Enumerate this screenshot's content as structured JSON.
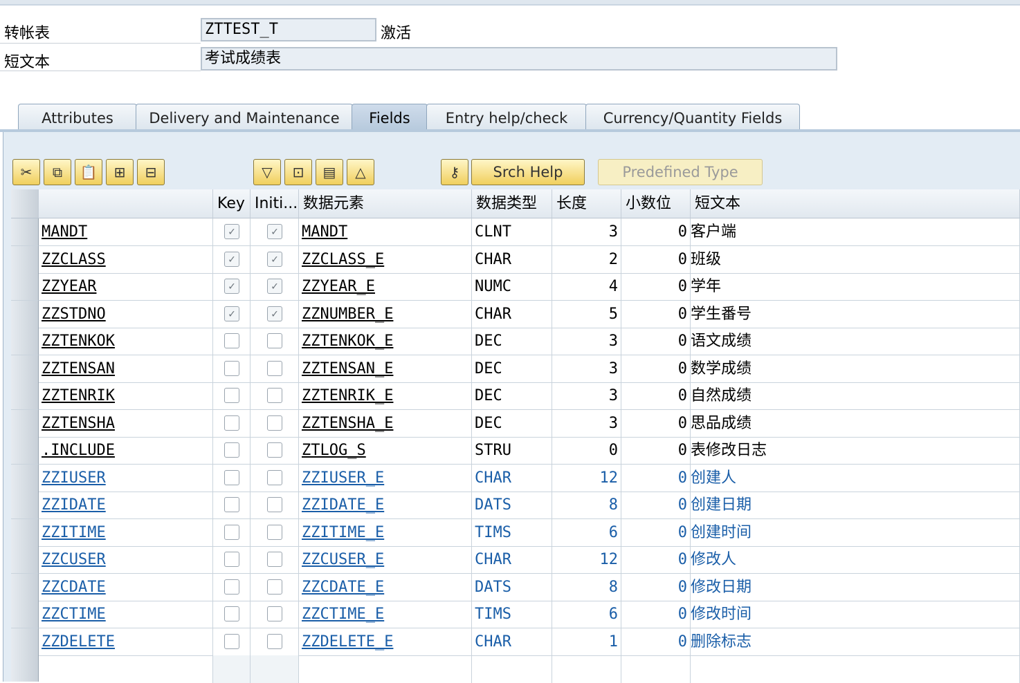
{
  "header": {
    "table_label": "转帐表",
    "table_value": "ZTTEST_T",
    "status": "激活",
    "desc_label": "短文本",
    "desc_value": "考试成绩表"
  },
  "tabs": [
    {
      "label": "Attributes"
    },
    {
      "label": "Delivery and Maintenance"
    },
    {
      "label": "Fields"
    },
    {
      "label": "Entry help/check"
    },
    {
      "label": "Currency/Quantity Fields"
    }
  ],
  "toolbar": {
    "srch_help": "Srch Help",
    "predefined_type": "Predefined Type"
  },
  "columns": {
    "key": "Key",
    "initial": "Initi...",
    "data_element": "数据元素",
    "data_type": "数据类型",
    "length": "长度",
    "decimals": "小数位",
    "short_text": "短文本"
  },
  "rows": [
    {
      "field": "MANDT",
      "key": true,
      "init": true,
      "elem": "MANDT",
      "type": "CLNT",
      "len": "3",
      "dec": "0",
      "text": "客户端",
      "blue": false
    },
    {
      "field": "ZZCLASS",
      "key": true,
      "init": true,
      "elem": "ZZCLASS_E",
      "type": "CHAR",
      "len": "2",
      "dec": "0",
      "text": "班级",
      "blue": false
    },
    {
      "field": "ZZYEAR",
      "key": true,
      "init": true,
      "elem": "ZZYEAR_E",
      "type": "NUMC",
      "len": "4",
      "dec": "0",
      "text": "学年",
      "blue": false
    },
    {
      "field": "ZZSTDNO",
      "key": true,
      "init": true,
      "elem": "ZZNUMBER_E",
      "type": "CHAR",
      "len": "5",
      "dec": "0",
      "text": "学生番号",
      "blue": false
    },
    {
      "field": "ZZTENKOK",
      "key": false,
      "init": false,
      "elem": "ZZTENKOK_E",
      "type": "DEC",
      "len": "3",
      "dec": "0",
      "text": "语文成绩",
      "blue": false
    },
    {
      "field": "ZZTENSAN",
      "key": false,
      "init": false,
      "elem": "ZZTENSAN_E",
      "type": "DEC",
      "len": "3",
      "dec": "0",
      "text": "数学成绩",
      "blue": false
    },
    {
      "field": "ZZTENRIK",
      "key": false,
      "init": false,
      "elem": "ZZTENRIK_E",
      "type": "DEC",
      "len": "3",
      "dec": "0",
      "text": "自然成绩",
      "blue": false
    },
    {
      "field": "ZZTENSHA",
      "key": false,
      "init": false,
      "elem": "ZZTENSHA_E",
      "type": "DEC",
      "len": "3",
      "dec": "0",
      "text": "思品成绩",
      "blue": false
    },
    {
      "field": ".INCLUDE",
      "key": false,
      "init": false,
      "elem": "ZTLOG_S",
      "type": "STRU",
      "len": "0",
      "dec": "0",
      "text": "表修改日志",
      "blue": false
    },
    {
      "field": "ZZIUSER",
      "key": false,
      "init": false,
      "elem": "ZZIUSER_E",
      "type": "CHAR",
      "len": "12",
      "dec": "0",
      "text": "创建人",
      "blue": true
    },
    {
      "field": "ZZIDATE",
      "key": false,
      "init": false,
      "elem": "ZZIDATE_E",
      "type": "DATS",
      "len": "8",
      "dec": "0",
      "text": "创建日期",
      "blue": true
    },
    {
      "field": "ZZITIME",
      "key": false,
      "init": false,
      "elem": "ZZITIME_E",
      "type": "TIMS",
      "len": "6",
      "dec": "0",
      "text": "创建时间",
      "blue": true
    },
    {
      "field": "ZZCUSER",
      "key": false,
      "init": false,
      "elem": "ZZCUSER_E",
      "type": "CHAR",
      "len": "12",
      "dec": "0",
      "text": "修改人",
      "blue": true
    },
    {
      "field": "ZZCDATE",
      "key": false,
      "init": false,
      "elem": "ZZCDATE_E",
      "type": "DATS",
      "len": "8",
      "dec": "0",
      "text": "修改日期",
      "blue": true
    },
    {
      "field": "ZZCTIME",
      "key": false,
      "init": false,
      "elem": "ZZCTIME_E",
      "type": "TIMS",
      "len": "6",
      "dec": "0",
      "text": "修改时间",
      "blue": true
    },
    {
      "field": "ZZDELETE",
      "key": false,
      "init": false,
      "elem": "ZZDELETE_E",
      "type": "CHAR",
      "len": "1",
      "dec": "0",
      "text": "删除标志",
      "blue": true
    }
  ]
}
